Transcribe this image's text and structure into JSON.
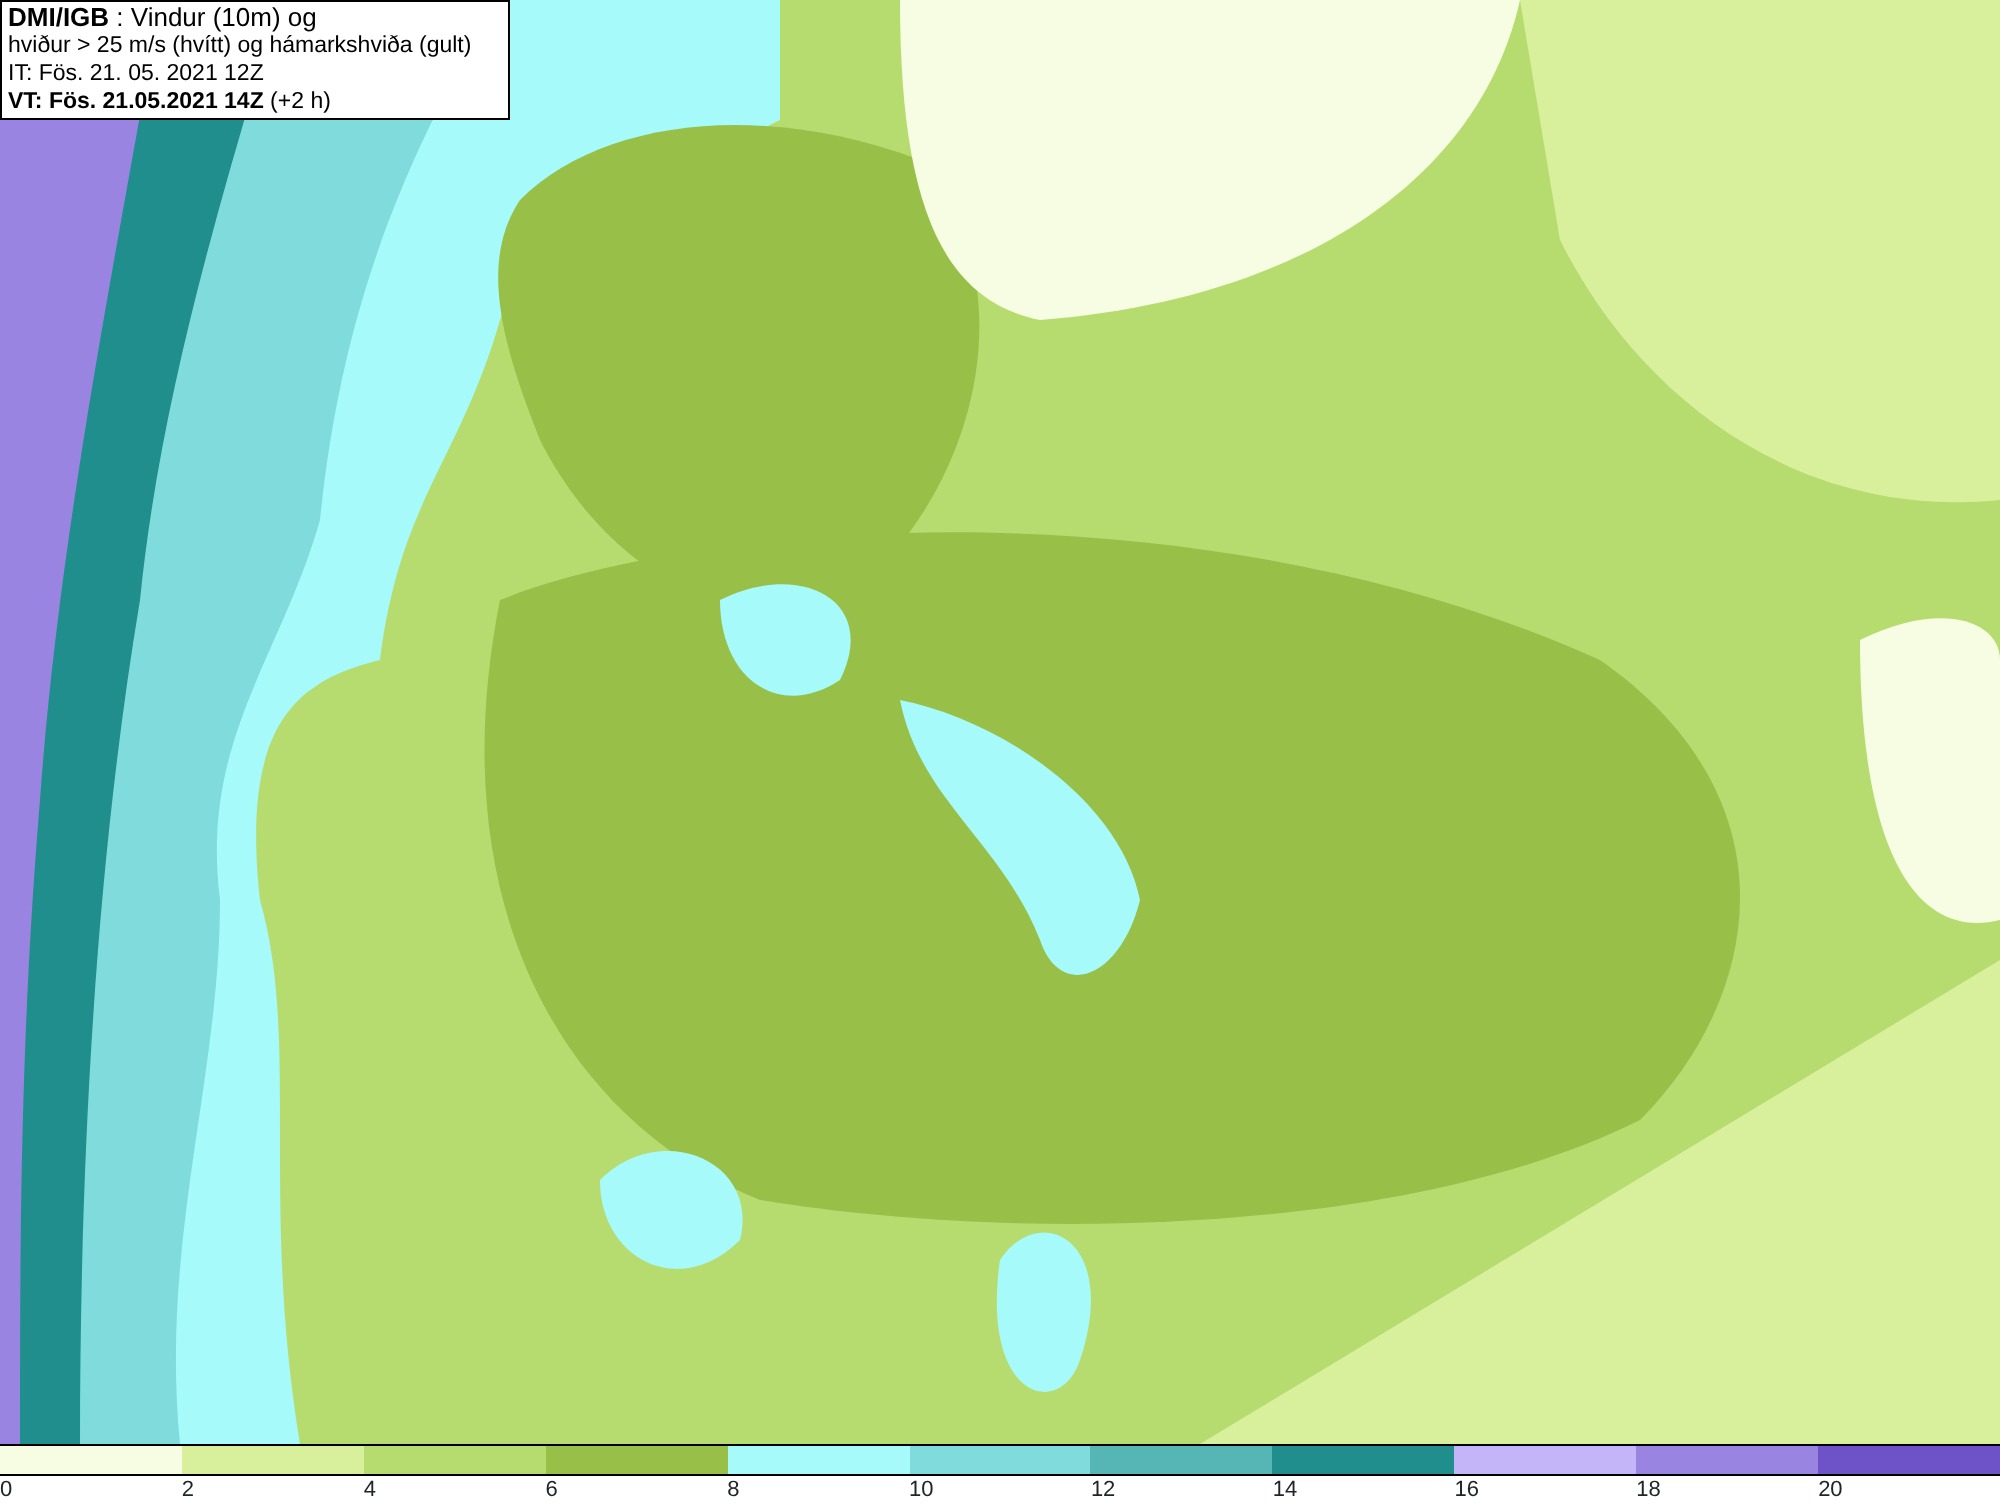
{
  "title_box": {
    "lines": [
      "**DMI/IGB** : Vindur (10m) og",
      "hviður > 25 m/s (hvítt) og hámarkshviða (gult)",
      "IT: Fös. 21. 05. 2021 12Z",
      "**VT: Fös. 21.05.2021 14Z** (+2 h)"
    ]
  },
  "legend": {
    "bins": [
      {
        "color": "#f6fde2",
        "label": "0"
      },
      {
        "color": "#d8f09c",
        "label": "2"
      },
      {
        "color": "#b6dc70",
        "label": "4"
      },
      {
        "color": "#98c048",
        "label": "6"
      },
      {
        "color": "#a6fafa",
        "label": "8"
      },
      {
        "color": "#80dcdc",
        "label": "10"
      },
      {
        "color": "#56b6b6",
        "label": "12"
      },
      {
        "color": "#208e8c",
        "label": "14"
      },
      {
        "color": "#c4b4f8",
        "label": "16"
      },
      {
        "color": "#9a84e2",
        "label": "18"
      },
      {
        "color": "#6e52c8",
        "label": "20"
      }
    ]
  }
}
